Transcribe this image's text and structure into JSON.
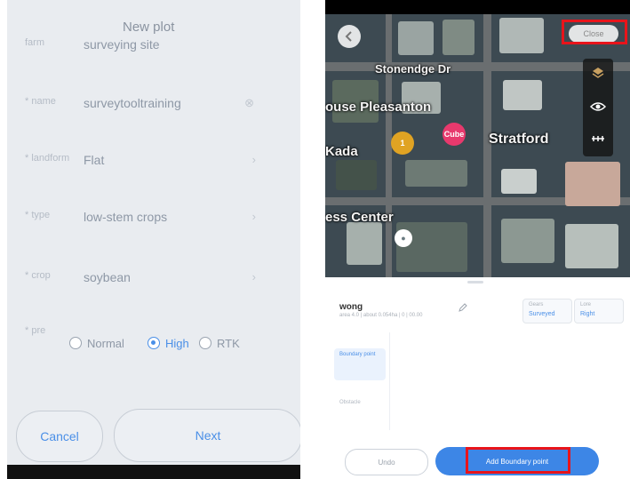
{
  "left_screen": {
    "title": "New plot",
    "fields": [
      {
        "label": "farm",
        "value": "surveying site",
        "has_chevron": false
      },
      {
        "label": "* name",
        "value": "surveytooltraining",
        "has_chevron": false
      },
      {
        "label": "* landform",
        "value": "Flat",
        "has_chevron": true
      },
      {
        "label": "* type",
        "value": "low-stem crops",
        "has_chevron": true
      },
      {
        "label": "* crop",
        "value": "soybean",
        "has_chevron": true
      }
    ],
    "accuracy_label": "* pre",
    "accuracy_options": [
      {
        "label": "Normal",
        "selected": false
      },
      {
        "label": "High",
        "selected": true
      },
      {
        "label": "RTK",
        "selected": false
      }
    ],
    "cancel_label": "Cancel",
    "next_label": "Next"
  },
  "right_screen": {
    "map": {
      "back_icon": "chevron-left-icon",
      "close_label": "Close",
      "labels": {
        "street": "Stonendge Dr",
        "place1": "ouse Pleasanton",
        "place2": "Stratford",
        "place3": "Kada",
        "place4": "ess Center",
        "pin_pink": "Cube"
      },
      "tool_icons": [
        "layers-icon",
        "eye-icon",
        "measure-icon"
      ]
    },
    "plot": {
      "name": "wong",
      "meta": "area 4.0 | about 0.054ha | 0 | 00.00",
      "tag1": {
        "label": "Gears",
        "value": "Surveyed"
      },
      "tag2": {
        "label": "Lore",
        "value": "Right"
      }
    },
    "side_tabs": [
      "Boundary point",
      "Obstacle"
    ],
    "undo_label": "Undo",
    "finish_label": "Add Boundary point"
  },
  "highlight_color": "#e8141b",
  "accent_color": "#3d86e6"
}
